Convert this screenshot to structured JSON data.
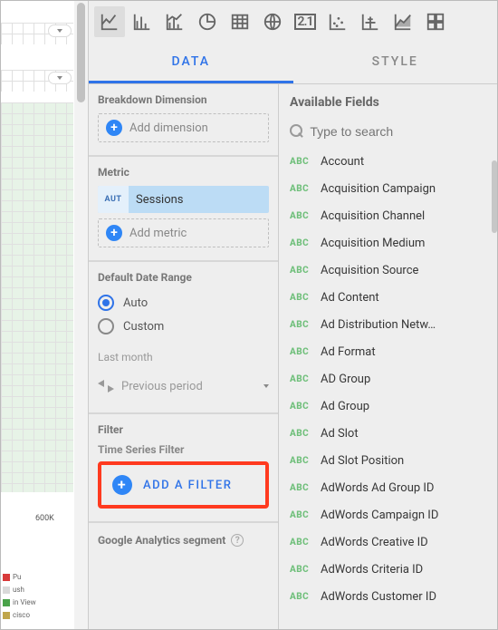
{
  "canvas": {
    "tick_label": "600K",
    "legend": [
      {
        "color": "#d83a3a",
        "label": "Pu"
      },
      {
        "color": "#d9d9d9",
        "label": "ush"
      },
      {
        "color": "#4aa24a",
        "label": "in View"
      },
      {
        "color": "#c0a64c",
        "label": "cisco"
      }
    ]
  },
  "chart_types": [
    {
      "name": "time-series",
      "active": true
    },
    {
      "name": "bar"
    },
    {
      "name": "combo"
    },
    {
      "name": "pie"
    },
    {
      "name": "table"
    },
    {
      "name": "geo"
    },
    {
      "name": "scorecard",
      "glyph": "2.1"
    },
    {
      "name": "scatter"
    },
    {
      "name": "bullet"
    },
    {
      "name": "area"
    },
    {
      "name": "pivot"
    }
  ],
  "tabs": {
    "data": "DATA",
    "style": "STYLE",
    "active": "data"
  },
  "left": {
    "breakdown": {
      "title": "Breakdown Dimension",
      "add": "Add dimension"
    },
    "metric": {
      "title": "Metric",
      "badge": "AUT",
      "value": "Sessions",
      "add": "Add metric"
    },
    "date_range": {
      "title": "Default Date Range",
      "auto": "Auto",
      "custom": "Custom",
      "selected": "auto",
      "sub": "Last month",
      "compare": "Previous period"
    },
    "filter": {
      "title": "Filter",
      "sub": "Time Series Filter",
      "add": "ADD A FILTER"
    },
    "ga": {
      "label": "Google Analytics segment"
    }
  },
  "right": {
    "title": "Available Fields",
    "placeholder": "Type to search",
    "type_badge": "ABC",
    "fields": [
      "Account",
      "Acquisition Campaign",
      "Acquisition Channel",
      "Acquisition Medium",
      "Acquisition Source",
      "Ad Content",
      "Ad Distribution Netw…",
      "Ad Format",
      "AD Group",
      "Ad Group",
      "Ad Slot",
      "Ad Slot Position",
      "AdWords Ad Group ID",
      "AdWords Campaign ID",
      "AdWords Creative ID",
      "AdWords Criteria ID",
      "AdWords Customer ID"
    ]
  }
}
